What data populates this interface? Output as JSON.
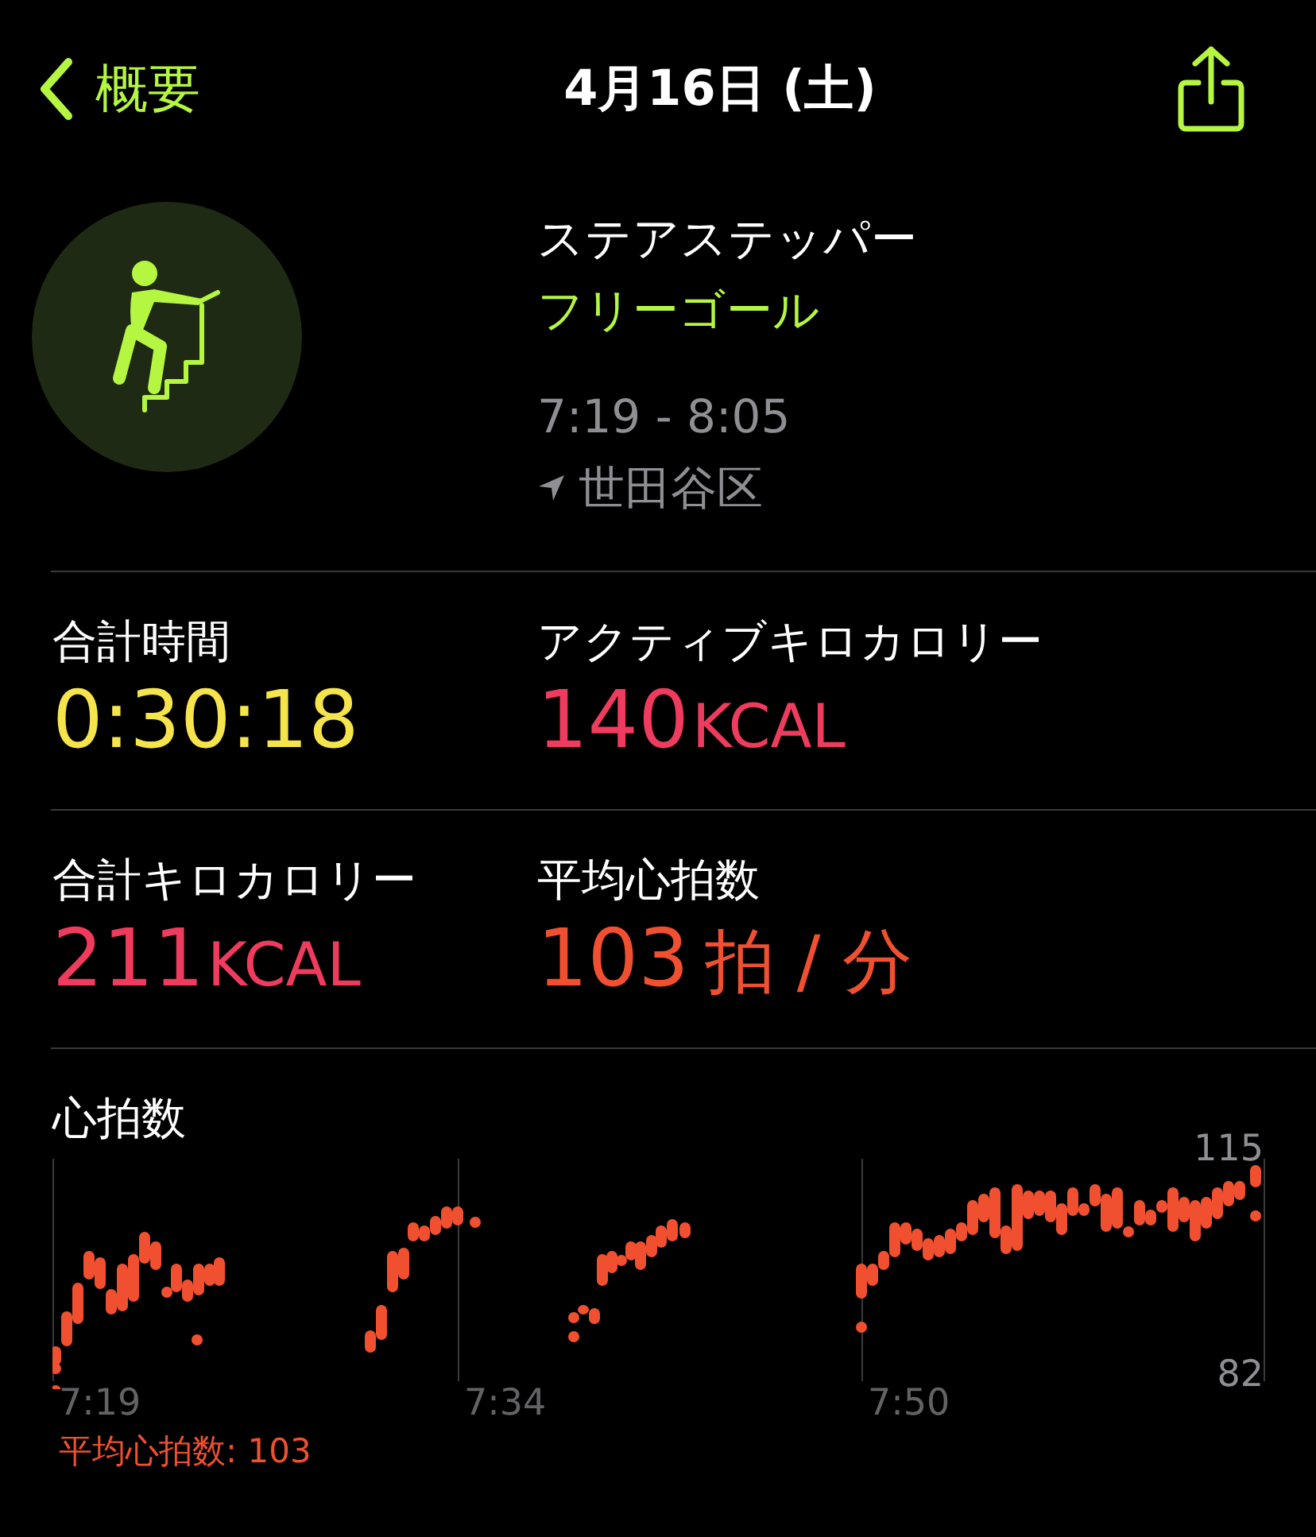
{
  "nav": {
    "back_label": "概要",
    "title": "4月16日 (土)"
  },
  "workout": {
    "name": "ステアステッパー",
    "goal": "フリーゴール",
    "time_range": "7:19 - 8:05",
    "location": "世田谷区"
  },
  "stats": [
    {
      "label": "合計時間",
      "value": "0:30:18",
      "kind": "time"
    },
    {
      "label": "アクティブキロカロリー",
      "value": "140",
      "unit": "KCAL",
      "kind": "calories"
    },
    {
      "label": "合計キロカロリー",
      "value": "211",
      "unit": "KCAL",
      "kind": "calories"
    },
    {
      "label": "平均心拍数",
      "value": "103",
      "unit": "拍 / 分",
      "kind": "heart"
    }
  ],
  "heart_rate": {
    "title": "心拍数",
    "y_max": "115",
    "y_min": "82",
    "x_labels": [
      "7:19",
      "7:34",
      "7:50"
    ],
    "average": "平均心拍数: 103"
  }
}
